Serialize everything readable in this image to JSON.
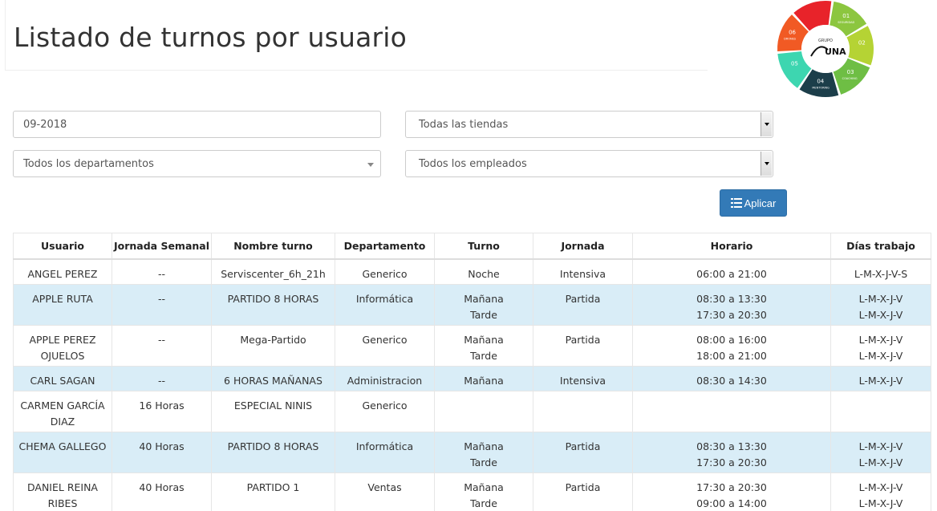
{
  "header": {
    "title": "Listado de turnos por usuario"
  },
  "logo": {
    "brand": "UNA",
    "group_label": "GRUPO",
    "segments": [
      {
        "num": "01",
        "label": "SEGURIDAD",
        "color": "#8cc63f"
      },
      {
        "num": "02",
        "label": "",
        "color": "#b5d334"
      },
      {
        "num": "03",
        "label": "COACHING",
        "color": "#6ebe44"
      },
      {
        "num": "04",
        "label": "MENTORING",
        "color": "#1c3e4a"
      },
      {
        "num": "05",
        "label": "",
        "color": "#3dd6b0"
      },
      {
        "num": "06",
        "label": "DRONES",
        "color": "#f15a24"
      },
      {
        "num": "",
        "label": "",
        "color": "#e8232a"
      }
    ]
  },
  "filters": {
    "month_value": "09-2018",
    "stores_value": "Todas las tiendas",
    "departments_value": "Todos los departamentos",
    "employees_value": "Todos los empleados",
    "apply_label": "Aplicar"
  },
  "table": {
    "columns": [
      "Usuario",
      "Jornada Semanal",
      "Nombre turno",
      "Departamento",
      "Turno",
      "Jornada",
      "Horario",
      "Días trabajo"
    ],
    "rows": [
      {
        "usuario": [
          "ANGEL PEREZ"
        ],
        "jornada_semanal": "--",
        "nombre_turno": "Serviscenter_6h_21h",
        "departamento": "Generico",
        "turno": [
          "Noche"
        ],
        "jornada": "Intensiva",
        "horario": [
          "06:00 a 21:00"
        ],
        "dias": [
          "L-M-X-J-V-S"
        ]
      },
      {
        "usuario": [
          "APPLE RUTA"
        ],
        "jornada_semanal": "--",
        "nombre_turno": "PARTIDO 8 HORAS",
        "departamento": "Informática",
        "turno": [
          "Mañana",
          "Tarde"
        ],
        "jornada": "Partida",
        "horario": [
          "08:30 a 13:30",
          "17:30 a 20:30"
        ],
        "dias": [
          "L-M-X-J-V",
          "L-M-X-J-V"
        ]
      },
      {
        "usuario": [
          "APPLE PEREZ",
          "OJUELOS"
        ],
        "jornada_semanal": "--",
        "nombre_turno": "Mega-Partido",
        "departamento": "Generico",
        "turno": [
          "Mañana",
          "Tarde"
        ],
        "jornada": "Partida",
        "horario": [
          "08:00 a 16:00",
          "18:00 a 21:00"
        ],
        "dias": [
          "L-M-X-J-V",
          "L-M-X-J-V"
        ]
      },
      {
        "usuario": [
          "CARL SAGAN"
        ],
        "jornada_semanal": "--",
        "nombre_turno": "6 HORAS MAÑANAS",
        "departamento": "Administracion",
        "turno": [
          "Mañana"
        ],
        "jornada": "Intensiva",
        "horario": [
          "08:30 a 14:30"
        ],
        "dias": [
          "L-M-X-J-V"
        ]
      },
      {
        "usuario": [
          "CARMEN GARCÍA",
          "DIAZ"
        ],
        "jornada_semanal": "16 Horas",
        "nombre_turno": "ESPECIAL NINIS",
        "departamento": "Generico",
        "turno": [],
        "jornada": "",
        "horario": [],
        "dias": []
      },
      {
        "usuario": [
          "CHEMA GALLEGO"
        ],
        "jornada_semanal": "40 Horas",
        "nombre_turno": "PARTIDO 8 HORAS",
        "departamento": "Informática",
        "turno": [
          "Mañana",
          "Tarde"
        ],
        "jornada": "Partida",
        "horario": [
          "08:30 a 13:30",
          "17:30 a 20:30"
        ],
        "dias": [
          "L-M-X-J-V",
          "L-M-X-J-V"
        ]
      },
      {
        "usuario": [
          "DANIEL REINA",
          "RIBES"
        ],
        "jornada_semanal": "40 Horas",
        "nombre_turno": "PARTIDO 1",
        "departamento": "Ventas",
        "turno": [
          "Mañana",
          "Tarde"
        ],
        "jornada": "Partida",
        "horario": [
          "17:30 a 20:30",
          "09:00 a 14:00"
        ],
        "dias": [
          "L-M-X-J-V",
          "L-M-X-J-V"
        ]
      }
    ]
  }
}
